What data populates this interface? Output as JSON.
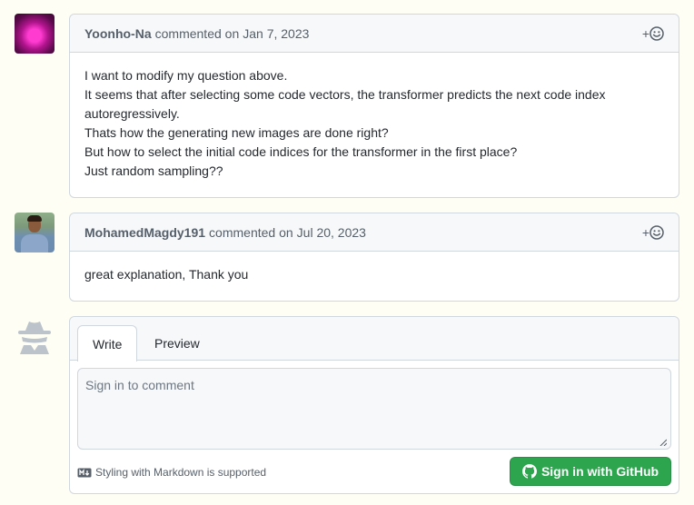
{
  "comments": [
    {
      "author": "Yoonho-Na",
      "action": "commented on",
      "date": "Jan 7, 2023",
      "body": [
        "I want to modify my question above.",
        "It seems that after selecting some code vectors, the transformer predicts the next code index",
        "autoregressively.",
        "Thats how the generating new images are done right?",
        "But how to select the initial code indices for the transformer in the first place?",
        "Just random sampling??"
      ]
    },
    {
      "author": "MohamedMagdy191",
      "action": "commented on",
      "date": "Jul 20, 2023",
      "body": [
        "great explanation, Thank you"
      ]
    }
  ],
  "reaction_label": "+",
  "editor": {
    "tabs": [
      "Write",
      "Preview"
    ],
    "placeholder": "Sign in to comment",
    "markdown_note": "Styling with Markdown is supported",
    "signin_label": "Sign in with GitHub"
  },
  "icons": {
    "reaction": "smiley-icon",
    "markdown": "markdown-icon",
    "github": "github-mark-icon",
    "anonymous": "incognito-icon"
  },
  "colors": {
    "page_bg": "#fefef4",
    "primary_button": "#2da44e",
    "border": "#d0d7de",
    "header_bg": "#f6f8fa"
  }
}
